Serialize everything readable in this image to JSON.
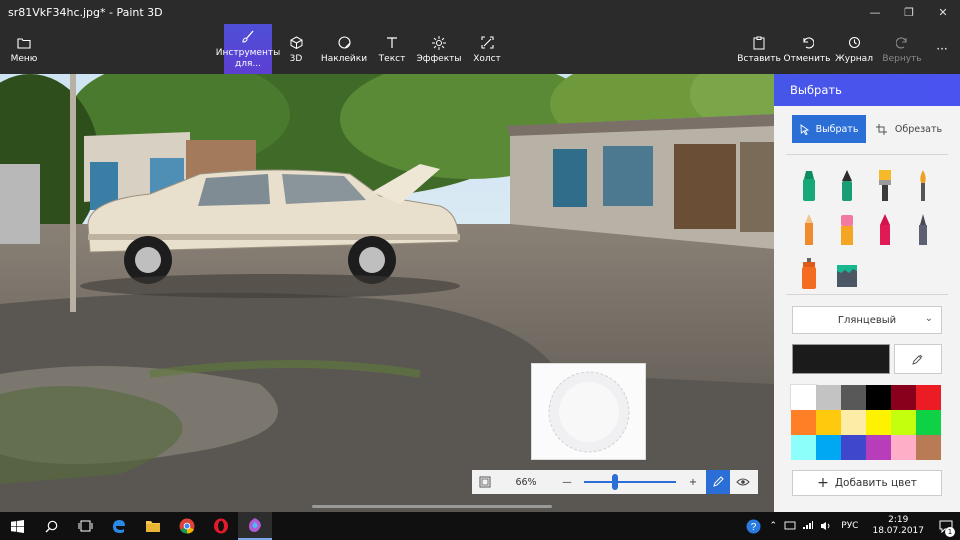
{
  "window": {
    "title": "sr81VkF34hc.jpg* - Paint 3D",
    "controls": [
      "minimize-icon",
      "restore-icon",
      "close-icon"
    ]
  },
  "ribbon": {
    "menu": "Меню",
    "tools": [
      {
        "label": "Инструменты для...",
        "icon": "brush-icon",
        "active": true
      },
      {
        "label": "3D",
        "icon": "cube-icon"
      },
      {
        "label": "Наклейки",
        "icon": "sticker-icon"
      },
      {
        "label": "Текст",
        "icon": "text-icon"
      },
      {
        "label": "Эффекты",
        "icon": "effects-icon"
      },
      {
        "label": "Холст",
        "icon": "canvas-icon"
      }
    ],
    "right": [
      {
        "label": "Вставить",
        "icon": "paste-icon"
      },
      {
        "label": "Отменить",
        "icon": "undo-icon"
      },
      {
        "label": "Журнал",
        "icon": "history-icon"
      },
      {
        "label": "Вернуть",
        "icon": "redo-icon",
        "disabled": true
      }
    ],
    "more": "···"
  },
  "panel": {
    "title": "Выбрать",
    "select_label": "Выбрать",
    "crop_label": "Обрезать",
    "brushes": [
      "marker-icon",
      "calligraphy-pen-icon",
      "oil-brush-icon",
      "watercolor-icon",
      "pencil-icon",
      "eraser-icon",
      "crayon-icon",
      "pixel-pen-icon",
      "spray-can-icon",
      "fill-bucket-icon"
    ],
    "finish": "Глянцевый",
    "current_color": "#1b1b1b",
    "palette": [
      "#ffffff",
      "#c3c3c3",
      "#585858",
      "#000000",
      "#88001b",
      "#ec1c24",
      "#ff7f27",
      "#ffc90e",
      "#fdeca6",
      "#fff200",
      "#c4ff0e",
      "#0ed145",
      "#8cfffb",
      "#00a8f3",
      "#3f48cc",
      "#b83dba",
      "#ffaec8",
      "#b97a56"
    ],
    "add_color": "Добавить цвет"
  },
  "zoom": {
    "percent": "66%",
    "level": 0.32
  },
  "taskbar": {
    "apps": [
      "windows-start-icon",
      "search-icon",
      "task-view-icon",
      "edge-icon",
      "file-explorer-icon",
      "chrome-icon",
      "opera-icon",
      "paint3d-icon"
    ],
    "lang": "РУС",
    "time": "2:19",
    "date": "18.07.2017",
    "notifications": "1"
  }
}
